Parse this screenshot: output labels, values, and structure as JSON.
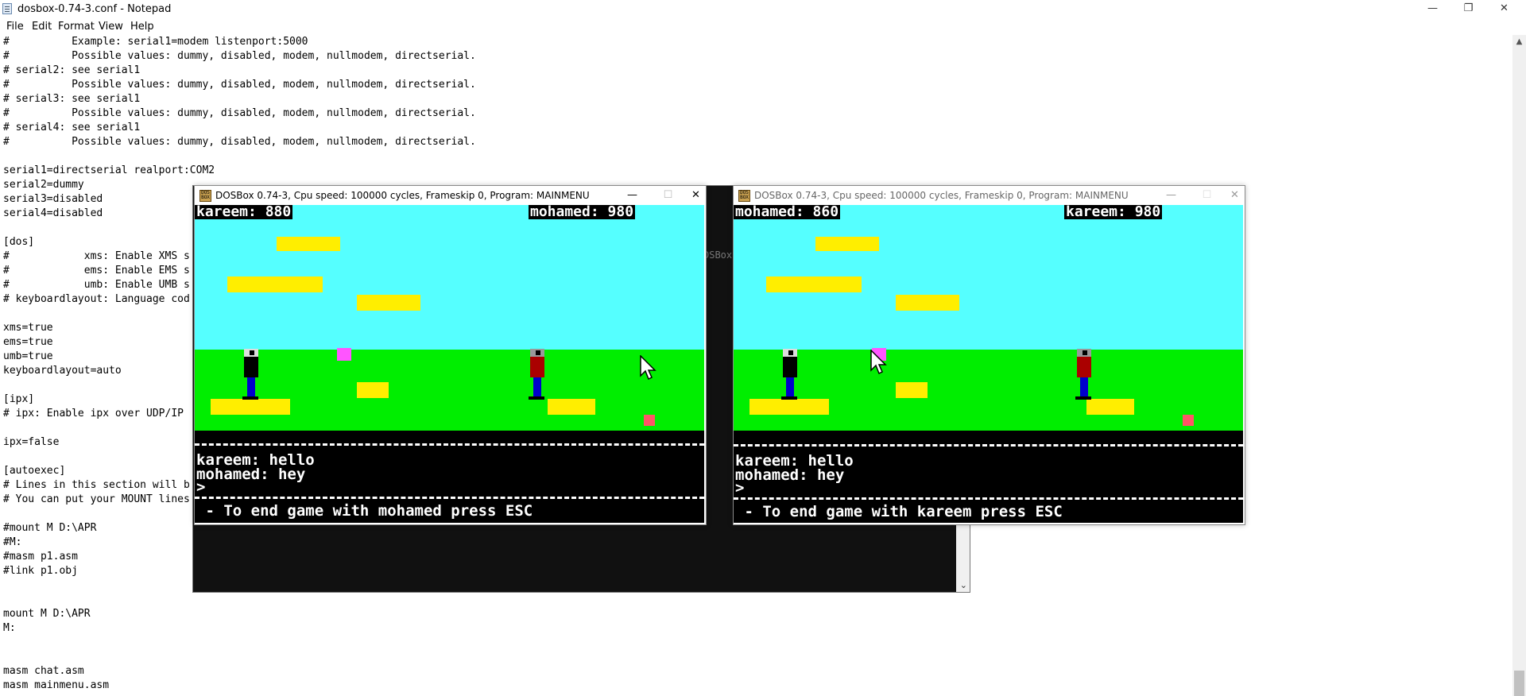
{
  "notepad": {
    "title": "dosbox-0.74-3.conf - Notepad",
    "menu": [
      "File",
      "Edit",
      "Format",
      "View",
      "Help"
    ],
    "controls": {
      "minimize": "—",
      "restore": "❐",
      "close": "✕"
    },
    "lines": [
      "#          Example: serial1=modem listenport:5000",
      "#          Possible values: dummy, disabled, modem, nullmodem, directserial.",
      "# serial2: see serial1",
      "#          Possible values: dummy, disabled, modem, nullmodem, directserial.",
      "# serial3: see serial1",
      "#          Possible values: dummy, disabled, modem, nullmodem, directserial.",
      "# serial4: see serial1",
      "#          Possible values: dummy, disabled, modem, nullmodem, directserial.",
      "",
      "serial1=directserial realport:COM2",
      "serial2=dummy",
      "serial3=disabled",
      "serial4=disabled",
      "",
      "[dos]",
      "#            xms: Enable XMS s",
      "#            ems: Enable EMS s",
      "#            umb: Enable UMB s",
      "# keyboardlayout: Language cod",
      "",
      "xms=true",
      "ems=true",
      "umb=true",
      "keyboardlayout=auto",
      "",
      "[ipx]",
      "# ipx: Enable ipx over UDP/IP",
      "",
      "ipx=false",
      "",
      "[autoexec]",
      "# Lines in this section will b",
      "# You can put your MOUNT lines",
      "",
      "#mount M D:\\APR",
      "#M:",
      "#masm p1.asm",
      "#link p1.obj",
      "",
      "",
      "mount M D:\\APR",
      "M:",
      "",
      "",
      "masm chat.asm",
      "masm mainmenu.asm"
    ]
  },
  "console_fragment": "DSBox",
  "dosbox_left": {
    "title": "DOSBox 0.74-3, Cpu speed:   100000 cycles, Frameskip  0, Program: MAINMENU",
    "controls": {
      "minimize": "—",
      "maximize": "☐",
      "close": "✕"
    },
    "score_left": "kareem: 880",
    "score_right": "mohamed: 980",
    "chat_lines": [
      "kareem: hello",
      "mohamed: hey",
      ">"
    ],
    "footer": " - To end game with mohamed press ESC"
  },
  "dosbox_right": {
    "title": "DOSBox 0.74-3, Cpu speed:   100000 cycles, Frameskip  0, Program: MAINMENU",
    "controls": {
      "minimize": "—",
      "maximize": "☐",
      "close": "✕"
    },
    "score_left": "mohamed: 860",
    "score_right": "kareem: 980",
    "chat_lines": [
      "kareem: hello",
      "mohamed: hey",
      ">"
    ],
    "footer": " - To end game with kareem press ESC"
  },
  "colors": {
    "sky": "#55ffff",
    "grass": "#00ee00",
    "platform": "#ffee00",
    "gem": "#ff55ff",
    "player1_shirt": "#000000",
    "player2_shirt": "#aa0000"
  }
}
